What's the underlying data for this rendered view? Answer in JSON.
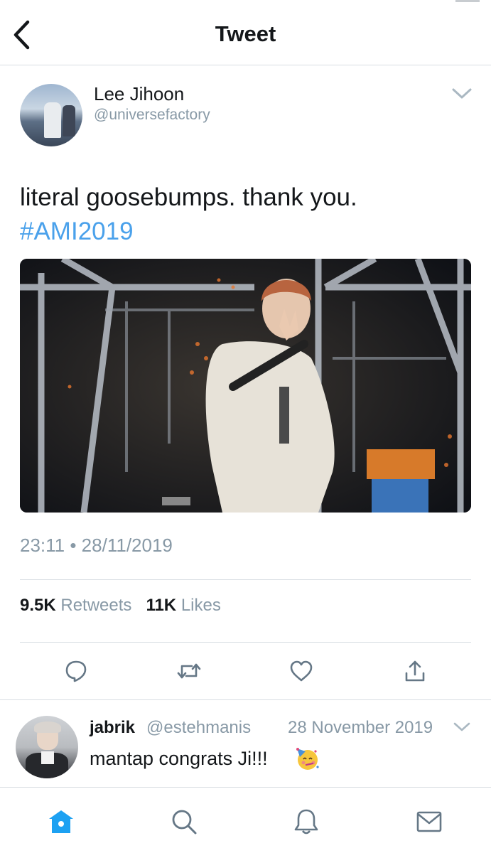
{
  "header": {
    "title": "Tweet"
  },
  "author": {
    "name": "Lee Jihoon",
    "handle": "@universefactory"
  },
  "tweet": {
    "text": "literal goosebumps. thank you.",
    "hashtag": "#AMI2019",
    "timestamp": "23:11 • 28/11/2019"
  },
  "stats": {
    "retweets_count": "9.5K",
    "retweets_label": "Retweets",
    "likes_count": "11K",
    "likes_label": "Likes"
  },
  "actions": [
    "reply-icon",
    "retweet-icon",
    "like-icon",
    "share-icon"
  ],
  "reply": {
    "name": "jabrik",
    "handle": "@estehmanis",
    "date": "28 November 2019",
    "text": "mantap congrats Ji!!!",
    "emoji": "partying-face-emoji"
  },
  "bottom_nav": [
    "home-icon",
    "search-icon",
    "notifications-icon",
    "messages-icon"
  ],
  "colors": {
    "accent": "#1da1f2",
    "hashtag": "#4aa1eb",
    "muted": "#8899a6",
    "divider": "#d8dde2",
    "icon": "#657786"
  }
}
